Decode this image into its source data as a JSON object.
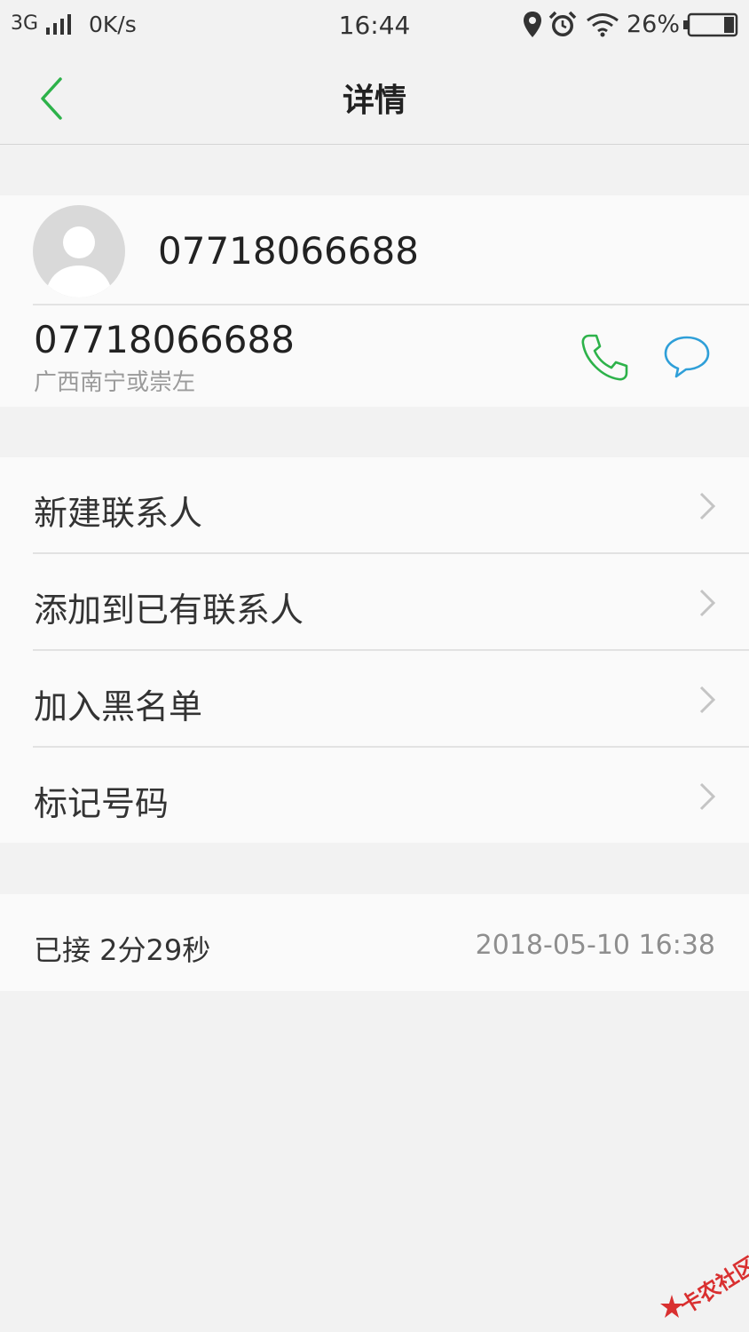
{
  "status_bar": {
    "network": "3G",
    "speed": "0K/s",
    "time": "16:44",
    "battery_percent": "26%"
  },
  "header": {
    "title": "详情"
  },
  "contact": {
    "name": "07718066688",
    "phone": "07718066688",
    "location": "广西南宁或崇左"
  },
  "menu": [
    {
      "label": "新建联系人"
    },
    {
      "label": "添加到已有联系人"
    },
    {
      "label": "加入黑名单"
    },
    {
      "label": "标记号码"
    }
  ],
  "call_log": {
    "status": "已接 2分29秒",
    "timestamp": "2018-05-10 16:38"
  },
  "watermark": {
    "text": "卡农社区"
  },
  "colors": {
    "accent_green": "#2db24a",
    "message_blue": "#2f9fd8"
  }
}
